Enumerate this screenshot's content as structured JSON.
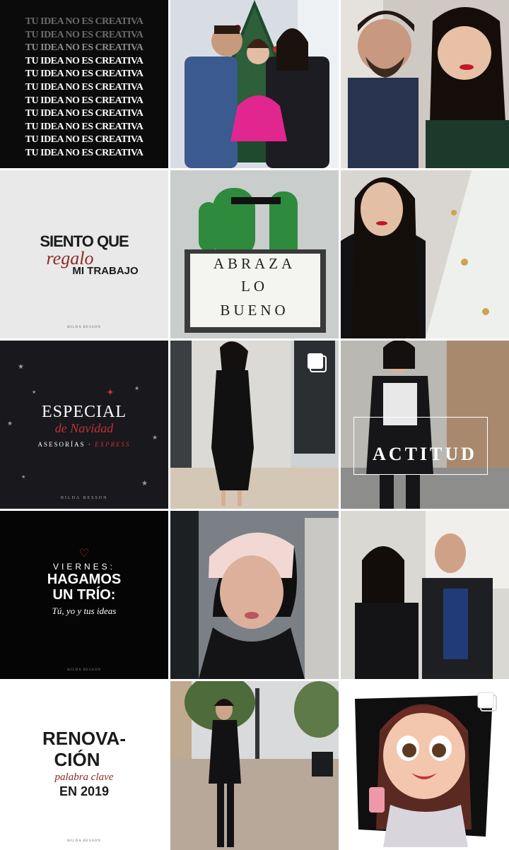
{
  "grid": {
    "colors": {
      "dark": "#19181d",
      "light": "#e9e9e9",
      "red": "#b52a2a",
      "white": "#ffffff"
    },
    "posts": [
      {
        "id": "p1",
        "alt_icon": "",
        "lines": [
          "TU IDEA NO ES CREATIVA",
          "TU IDEA NO ES CREATIVA",
          "TU IDEA NO ES CREATIVA",
          "TU IDEA NO ES CREATIVA",
          "TU IDEA NO ES CREATIVA",
          "TU IDEA NO ES CREATIVA",
          "TU IDEA NO ES CREATIVA",
          "TU IDEA NO ES CREATIVA",
          "TU IDEA NO ES CREATIVA",
          "TU IDEA NO ES CREATIVA",
          "TU IDEA NO ES CREATIVA"
        ]
      },
      {
        "id": "p2"
      },
      {
        "id": "p3"
      },
      {
        "id": "p4",
        "line1": "SIENTO QUE",
        "line2": "regalo",
        "line3": "MI TRABAJO",
        "footer": "HILDA BESSON"
      },
      {
        "id": "p5",
        "row1": "ABRAZA",
        "row2": "LO",
        "row3": "BUENO"
      },
      {
        "id": "p6"
      },
      {
        "id": "p7",
        "line1": "ESPECIAL",
        "line2": "de Navidad",
        "line3a": "ASESORÍAS · ",
        "line3b": "EXPRESS",
        "footer": "HILDA BESSON"
      },
      {
        "id": "p8",
        "multi": true
      },
      {
        "id": "p9",
        "overlay": "ACTITUD"
      },
      {
        "id": "p10",
        "line1": "VIERNES:",
        "line2": "HAGAMOS",
        "line3": "UN TRÍO:",
        "line4": "Tú, yo y tus ideas",
        "footer": "HILDA BESSON"
      },
      {
        "id": "p11"
      },
      {
        "id": "p12"
      },
      {
        "id": "p13",
        "line1": "RENOVA-",
        "line2": "CIÓN",
        "line3": "palabra clave",
        "line4": "EN 2019",
        "footer": "HILDA BESSON"
      },
      {
        "id": "p14"
      },
      {
        "id": "p15",
        "multi": true
      }
    ]
  }
}
